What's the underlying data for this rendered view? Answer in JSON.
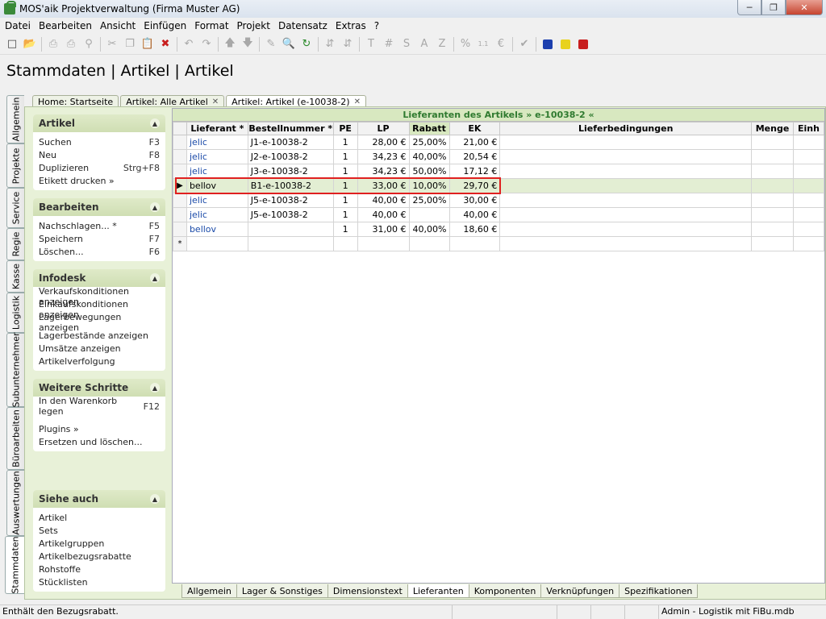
{
  "window": {
    "title": "MOS'aik Projektverwaltung (Firma Muster AG)"
  },
  "menu": [
    "Datei",
    "Bearbeiten",
    "Ansicht",
    "Einfügen",
    "Format",
    "Projekt",
    "Datensatz",
    "Extras",
    "?"
  ],
  "page_title": "Stammdaten | Artikel | Artikel",
  "vertical_tabs": [
    "Allgemein",
    "Projekte",
    "Service",
    "Regie",
    "Kasse",
    "Logistik",
    "Subunternehmer",
    "Büroarbeiten",
    "Auswertungen",
    "Stammdaten"
  ],
  "doc_tabs": [
    "Home: Startseite",
    "Artikel: Alle Artikel",
    "Artikel: Artikel (e-10038-2)"
  ],
  "sidebar": {
    "artikel": {
      "title": "Artikel",
      "items": [
        {
          "label": "Suchen",
          "key": "F3"
        },
        {
          "label": "Neu",
          "key": "F8"
        },
        {
          "label": "Duplizieren",
          "key": "Strg+F8"
        },
        {
          "label": "Etikett drucken »",
          "key": ""
        }
      ]
    },
    "bearbeiten": {
      "title": "Bearbeiten",
      "items": [
        {
          "label": "Nachschlagen... *",
          "key": "F5"
        },
        {
          "label": "Speichern",
          "key": "F7"
        },
        {
          "label": "Löschen...",
          "key": "F6"
        }
      ]
    },
    "infodesk": {
      "title": "Infodesk",
      "items": [
        "Verkaufskonditionen anzeigen",
        "Einkaufskonditionen anzeigen",
        "Lagerbewegungen anzeigen",
        "Lagerbestände anzeigen",
        "Umsätze anzeigen",
        "Artikelverfolgung"
      ]
    },
    "weitere": {
      "title": "Weitere Schritte",
      "items": [
        {
          "label": "In den Warenkorb legen",
          "key": "F12"
        },
        {
          "label": "Plugins »",
          "key": ""
        },
        {
          "label": "Ersetzen und löschen...",
          "key": ""
        }
      ]
    },
    "siehe": {
      "title": "Siehe auch",
      "items": [
        "Artikel",
        "Sets",
        "Artikelgruppen",
        "Artikelbezugsrabatte",
        "Rohstoffe",
        "Stücklisten"
      ]
    }
  },
  "grid": {
    "caption": "Lieferanten des Artikels » e-10038-2 «",
    "columns": [
      "Lieferant *",
      "Bestellnummer *",
      "PE",
      "LP",
      "Rabatt",
      "EK",
      "Lieferbedingungen",
      "Menge",
      "Einh"
    ],
    "rows": [
      [
        "jelic",
        "J1-e-10038-2",
        "1",
        "28,00 €",
        "25,00%",
        "21,00 €",
        "",
        "",
        ""
      ],
      [
        "jelic",
        "J2-e-10038-2",
        "1",
        "34,23 €",
        "40,00%",
        "20,54 €",
        "",
        "",
        ""
      ],
      [
        "jelic",
        "J3-e-10038-2",
        "1",
        "34,23 €",
        "50,00%",
        "17,12 €",
        "",
        "",
        ""
      ],
      [
        "bellov",
        "B1-e-10038-2",
        "1",
        "33,00 €",
        "10,00%",
        "29,70 €",
        "",
        "",
        ""
      ],
      [
        "jelic",
        "J5-e-10038-2",
        "1",
        "40,00 €",
        "25,00%",
        "30,00 €",
        "",
        "",
        ""
      ],
      [
        "jelic",
        "J5-e-10038-2",
        "1",
        "40,00 €",
        "",
        "40,00 €",
        "",
        "",
        ""
      ],
      [
        "bellov",
        "",
        "1",
        "31,00 €",
        "40,00%",
        "18,60 €",
        "",
        "",
        ""
      ]
    ],
    "new_row_marker": "*",
    "current_row_marker": "▶"
  },
  "bottom_tabs": [
    "Allgemein",
    "Lager & Sonstiges",
    "Dimensionstext",
    "Lieferanten",
    "Komponenten",
    "Verknüpfungen",
    "Spezifikationen"
  ],
  "status": {
    "message": "Enthält den Bezugsrabatt.",
    "user": "Admin - Logistik mit FiBu.mdb"
  }
}
